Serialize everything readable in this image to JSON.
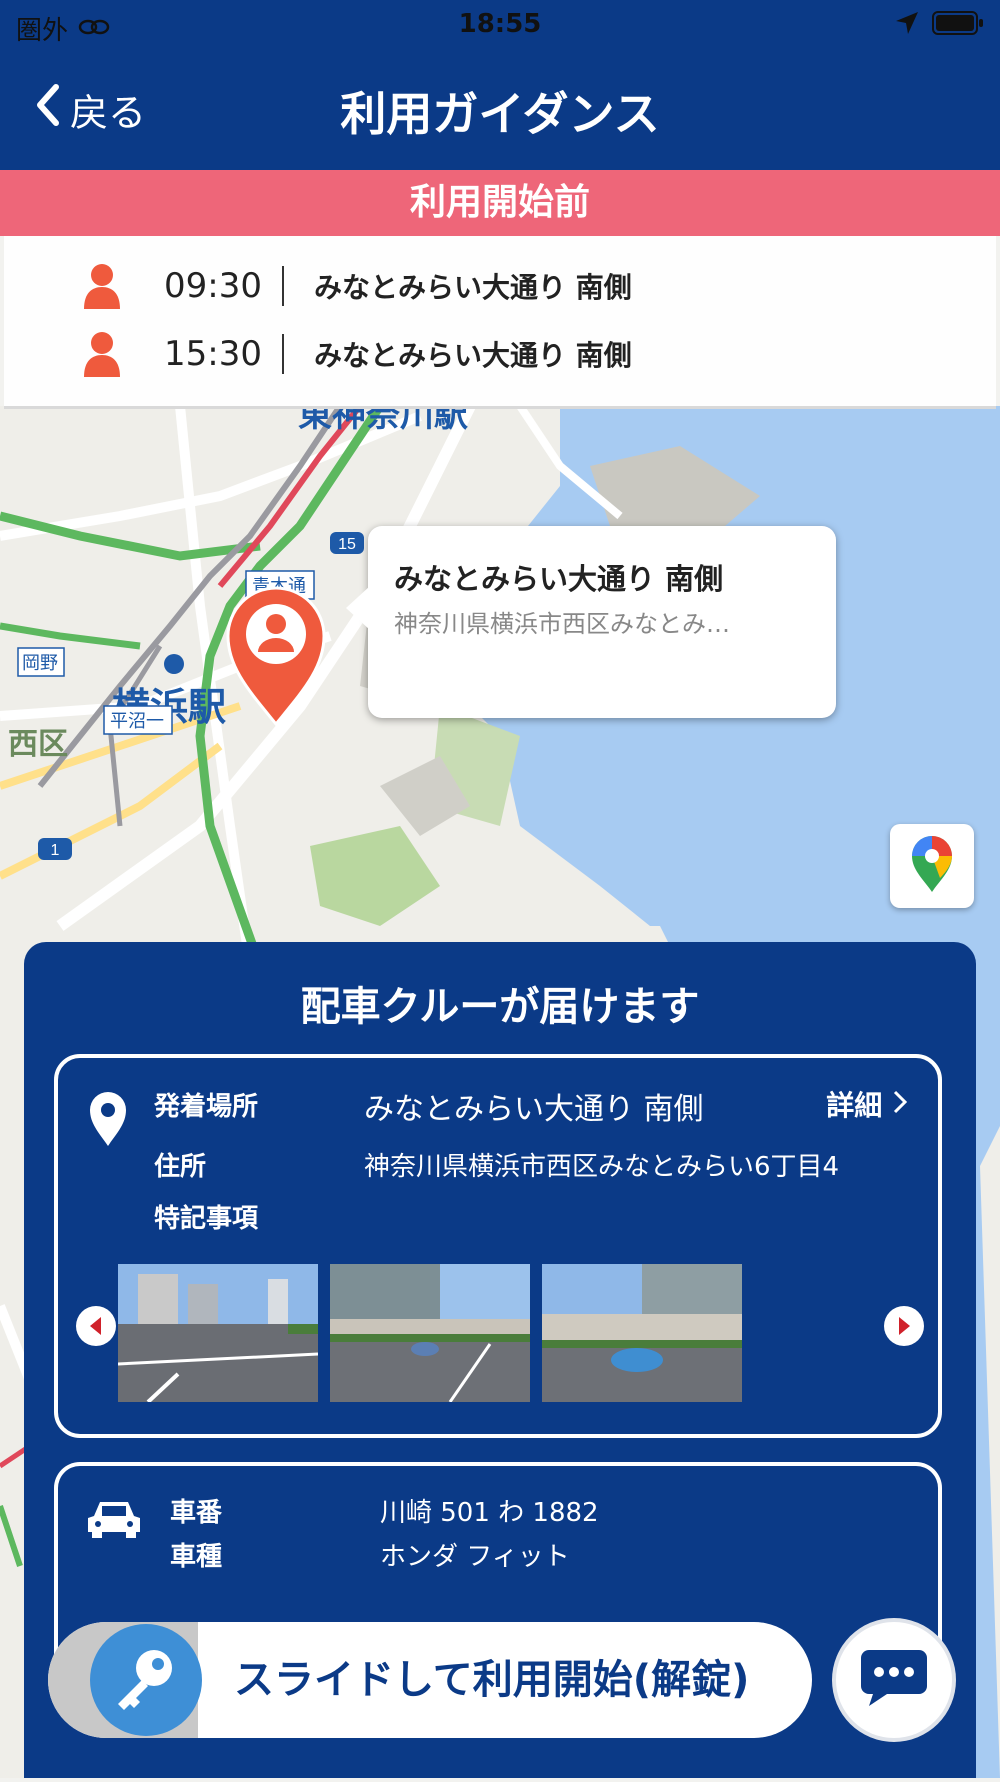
{
  "status_bar": {
    "carrier": "圏外",
    "time": "18:55"
  },
  "nav": {
    "back_label": "戻る",
    "title": "利用ガイダンス"
  },
  "stage_banner": "利用開始前",
  "schedule": [
    {
      "time": "09:30",
      "place": "みなとみらい大通り 南側"
    },
    {
      "time": "15:30",
      "place": "みなとみらい大通り 南側"
    }
  ],
  "map": {
    "labels": [
      {
        "text": "東神奈川駅",
        "kind": "station"
      },
      {
        "text": "横浜駅",
        "kind": "station"
      },
      {
        "text": "青木通",
        "kind": "road"
      },
      {
        "text": "岡野",
        "kind": "road"
      },
      {
        "text": "平沼一",
        "kind": "road"
      },
      {
        "text": "西区",
        "kind": "ward"
      },
      {
        "text": "15",
        "kind": "route"
      },
      {
        "text": "1",
        "kind": "route"
      }
    ],
    "callout": {
      "title": "みなとみらい大通り 南側",
      "address": "神奈川県横浜市西区みなとみ…"
    }
  },
  "panel": {
    "title": "配車クルーが届けます",
    "location": {
      "label": "発着場所",
      "value": "みなとみらい大通り 南側",
      "detail_label": "詳細"
    },
    "address": {
      "label": "住所",
      "value": "神奈川県横浜市西区みなとみらい6丁目4"
    },
    "notes": {
      "label": "特記事項"
    },
    "vehicle": {
      "plate_label": "車番",
      "plate_value": "川崎 501 わ 1882",
      "model_label": "車種",
      "model_value": "ホンダ フィット"
    }
  },
  "slider": {
    "label": "スライドして利用開始(解錠)"
  },
  "colors": {
    "navy": "#0b3a87",
    "pink_banner": "#ee6679",
    "orange_pin": "#ef5a3d",
    "water": "#a7cbf2"
  }
}
